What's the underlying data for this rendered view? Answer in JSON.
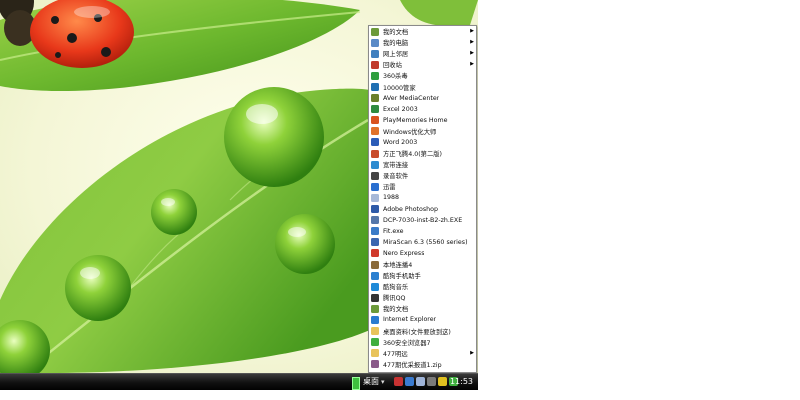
{
  "start_menu": {
    "items": [
      {
        "label": "我的文档",
        "icon": "my-documents-icon",
        "icon_color": "#6c9a3a",
        "has_submenu": true
      },
      {
        "label": "我的电脑",
        "icon": "my-computer-icon",
        "icon_color": "#5a8ac6",
        "has_submenu": true
      },
      {
        "label": "网上邻居",
        "icon": "network-places-icon",
        "icon_color": "#3f7fbf",
        "has_submenu": true
      },
      {
        "label": "回收站",
        "icon": "recycle-bin-icon",
        "icon_color": "#c0392b",
        "has_submenu": true
      },
      {
        "label": "360杀毒",
        "icon": "antivirus-shield-icon",
        "icon_color": "#2e9e3e",
        "has_submenu": false
      },
      {
        "label": "10000管家",
        "icon": "housekeeper-icon",
        "icon_color": "#1f6fb2",
        "has_submenu": false
      },
      {
        "label": "AVer MediaCenter",
        "icon": "media-center-icon",
        "icon_color": "#6b7f2a",
        "has_submenu": false
      },
      {
        "label": "Excel 2003",
        "icon": "excel-icon",
        "icon_color": "#2f8a3e",
        "has_submenu": false
      },
      {
        "label": "PlayMemories Home",
        "icon": "playmemories-icon",
        "icon_color": "#d9531e",
        "has_submenu": false
      },
      {
        "label": "Windows优化大师",
        "icon": "optimizer-icon",
        "icon_color": "#e0722a",
        "has_submenu": false
      },
      {
        "label": "Word 2003",
        "icon": "word-icon",
        "icon_color": "#2b5cb8",
        "has_submenu": false
      },
      {
        "label": "方正飞腾4.0(第二版)",
        "icon": "founder-icon",
        "icon_color": "#c84b2a",
        "has_submenu": false
      },
      {
        "label": "宽带连接",
        "icon": "broadband-icon",
        "icon_color": "#2d8bd0",
        "has_submenu": false
      },
      {
        "label": "录音软件",
        "icon": "recorder-icon",
        "icon_color": "#444444",
        "has_submenu": false
      },
      {
        "label": "迅雷",
        "icon": "thunder-icon",
        "icon_color": "#2a6fd0",
        "has_submenu": false
      },
      {
        "label": "1988",
        "icon": "bulb-icon",
        "icon_color": "#a7b9d8",
        "has_submenu": false
      },
      {
        "label": "Adobe Photoshop",
        "icon": "photoshop-icon",
        "icon_color": "#2e5aa8",
        "has_submenu": false
      },
      {
        "label": "DCP-7030-inst-B2-zh.EXE",
        "icon": "installer-icon",
        "icon_color": "#5577aa",
        "has_submenu": false
      },
      {
        "label": "Fit.exe",
        "icon": "fit-icon",
        "icon_color": "#3a7bc8",
        "has_submenu": false
      },
      {
        "label": "MiraScan 6.3 (5560 series)",
        "icon": "scanner-icon",
        "icon_color": "#3a66b0",
        "has_submenu": false
      },
      {
        "label": "Nero Express",
        "icon": "nero-icon",
        "icon_color": "#d0392b",
        "has_submenu": false
      },
      {
        "label": "本地连播4",
        "icon": "player-icon",
        "icon_color": "#8a6a3a",
        "has_submenu": false
      },
      {
        "label": "酷狗手机助手",
        "icon": "kugou-phone-icon",
        "icon_color": "#2a7fd0",
        "has_submenu": false
      },
      {
        "label": "酷狗音乐",
        "icon": "kugou-music-icon",
        "icon_color": "#1f8ad8",
        "has_submenu": false
      },
      {
        "label": "腾讯QQ",
        "icon": "qq-icon",
        "icon_color": "#333333",
        "has_submenu": false
      },
      {
        "label": "我的文档",
        "icon": "my-documents-icon",
        "icon_color": "#6c9a3a",
        "has_submenu": false
      },
      {
        "label": "Internet Explorer",
        "icon": "internet-explorer-icon",
        "icon_color": "#2a7bd0",
        "has_submenu": false
      },
      {
        "label": "桌面资料(文件要放到这)",
        "icon": "folder-icon",
        "icon_color": "#e8c35a",
        "has_submenu": false
      },
      {
        "label": "360安全浏览器7",
        "icon": "browser-360-icon",
        "icon_color": "#3fae3f",
        "has_submenu": false
      },
      {
        "label": "477明远",
        "icon": "folder-icon",
        "icon_color": "#e8c35a",
        "has_submenu": true
      },
      {
        "label": "477期优采报道1.zip",
        "icon": "zip-archive-icon",
        "icon_color": "#8a5a8a",
        "has_submenu": false
      }
    ]
  },
  "taskbar": {
    "desktop_label": "桌面",
    "arrow": "▾",
    "clock": "11:53",
    "tray_icons": [
      {
        "name": "tray-red-icon",
        "color": "#c83232"
      },
      {
        "name": "tray-blue-icon",
        "color": "#3a7bd0"
      },
      {
        "name": "tray-network-icon",
        "color": "#9fb4d8"
      },
      {
        "name": "tray-security-icon",
        "color": "#7a7a7a"
      },
      {
        "name": "tray-yellow-icon",
        "color": "#e0c020"
      },
      {
        "name": "tray-green-icon",
        "color": "#3fae3f"
      }
    ]
  }
}
